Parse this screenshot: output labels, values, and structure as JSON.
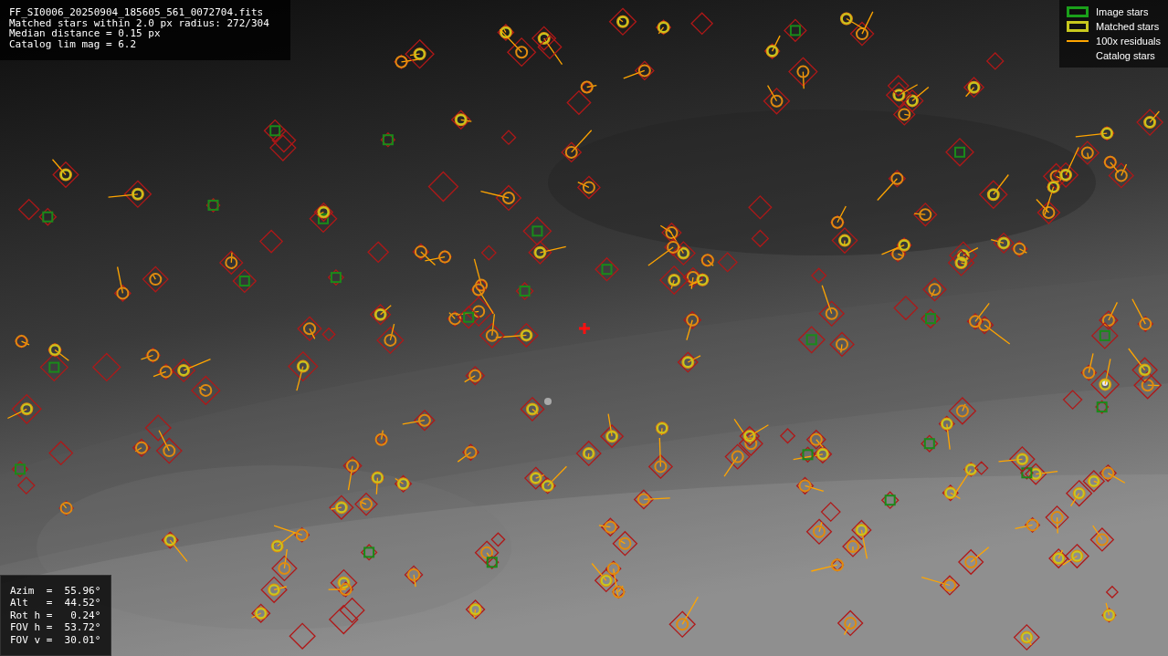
{
  "header": {
    "lines": [
      "FF_SI0006_20250904_185605_561_0072704.fits",
      "Matched stars within 2.0 px radius: 272/304",
      "Median distance = 0.15 px",
      "Catalog lim mag = 6.2"
    ]
  },
  "legend": [
    {
      "label": "Image stars",
      "kind": "box",
      "color": "#1aa01a"
    },
    {
      "label": "Matched stars",
      "kind": "box",
      "color": "#c8c81e"
    },
    {
      "label": "100x residuals",
      "kind": "line",
      "color": "#ffa500"
    },
    {
      "label": "Catalog stars",
      "kind": "none"
    }
  ],
  "pointing": {
    "lines": [
      "Azim  =  55.96°",
      "Alt   =  44.52°",
      "Rot h =   0.24°",
      "FOV h =  53.72°",
      "FOV v =  30.01°"
    ]
  }
}
